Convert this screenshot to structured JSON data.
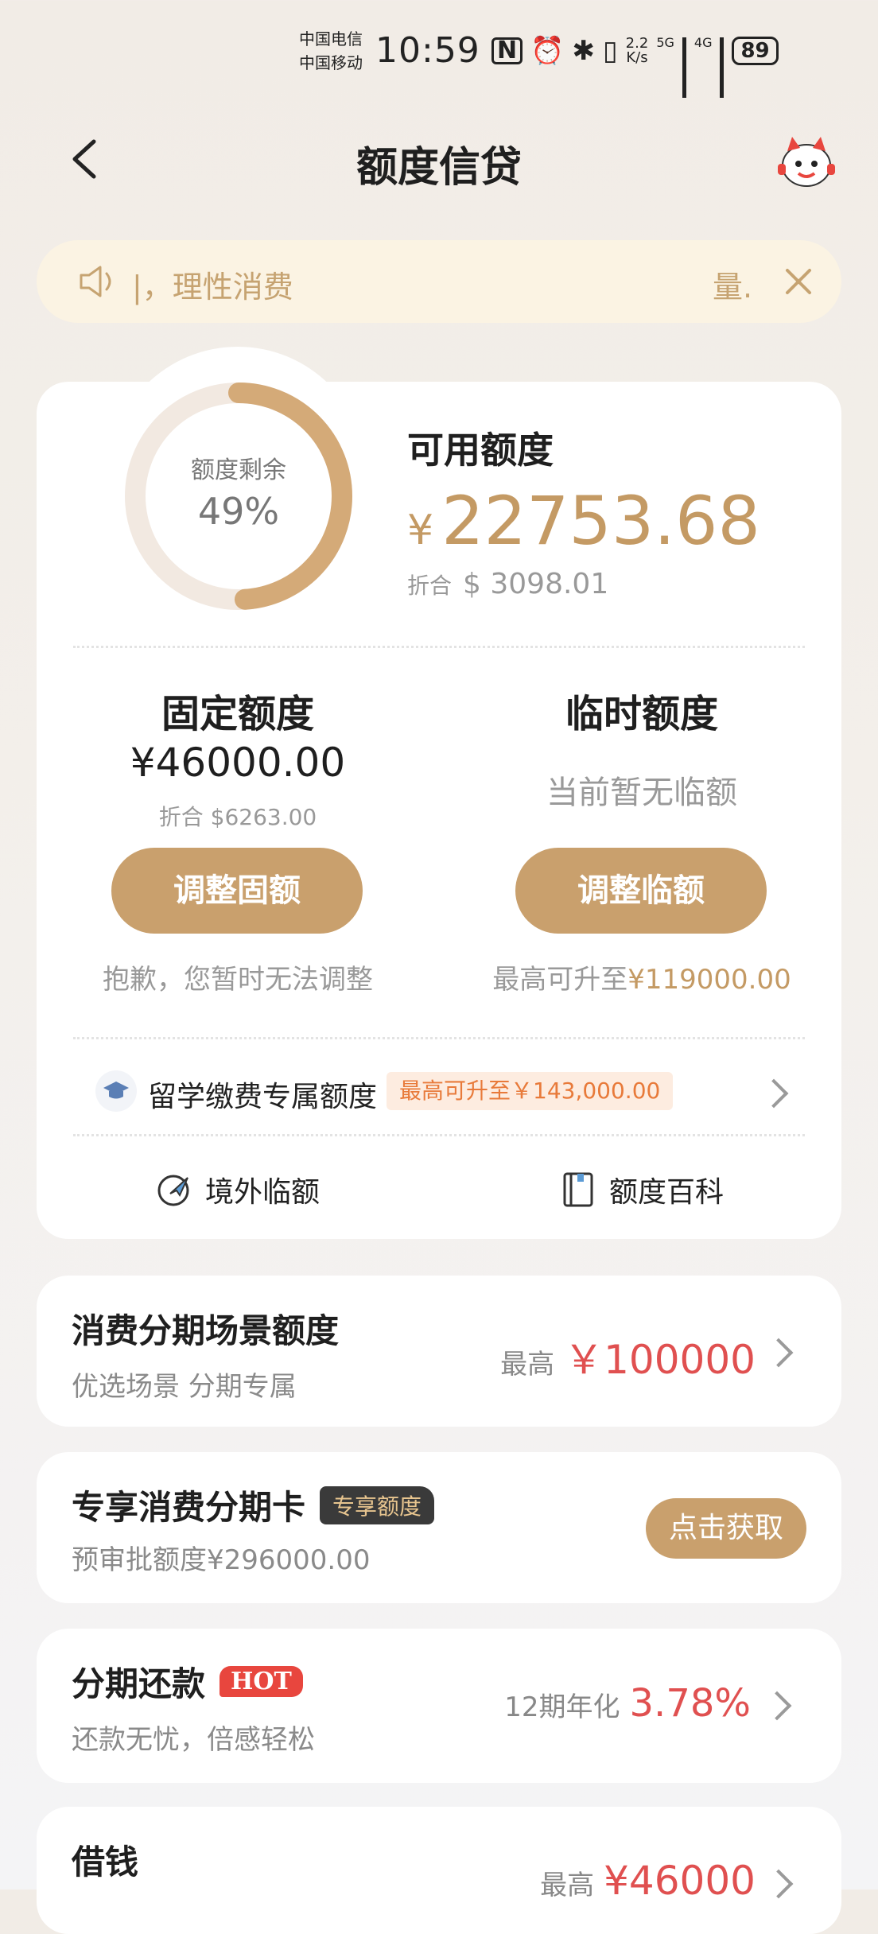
{
  "status_bar": {
    "carrier_1": "中国电信",
    "carrier_2": "中国移动",
    "time": "10:59",
    "net_speed_value": "2.2",
    "net_speed_unit": "K/s",
    "sig1_label": "5G",
    "sig2_label": "4G",
    "battery": "89"
  },
  "header": {
    "title": "额度信贷"
  },
  "notice": {
    "text": "|，理性消费",
    "text_tail": "量."
  },
  "summary": {
    "ring_label": "额度剩余",
    "ring_percent": "49%",
    "ring_fraction": 0.49,
    "available_label": "可用额度",
    "available_currency": "¥",
    "available_amount": "22753.68",
    "converted_prefix": "折合",
    "converted_amount": "$ 3098.01"
  },
  "fixed": {
    "title": "固定额度",
    "amount": "¥46000.00",
    "converted": "折合 $6263.00",
    "button": "调整固额",
    "note": "抱歉，您暂时无法调整"
  },
  "temporary": {
    "title": "临时额度",
    "status": "当前暂无临额",
    "button": "调整临额",
    "note_prefix": "最高可升至",
    "note_amount": "¥119000.00"
  },
  "study": {
    "label": "留学缴费专属额度",
    "badge": "最高可升至￥143,000.00"
  },
  "links": {
    "overseas": "境外临额",
    "wiki": "额度百科"
  },
  "installment_scene": {
    "title": "消费分期场景额度",
    "subtitle": "优选场景 分期专属",
    "right_label": "最高",
    "right_value": "￥100000"
  },
  "exclusive_card": {
    "title": "专享消费分期卡",
    "badge": "专享额度",
    "subtitle": "预审批额度¥296000.00",
    "button": "点击获取"
  },
  "repayment": {
    "title": "分期还款",
    "badge": "HOT",
    "subtitle": "还款无忧，倍感轻松",
    "right_label": "12期年化",
    "right_value": "3.78%"
  },
  "borrow": {
    "title": "借钱",
    "right_label": "最高",
    "right_value": "¥46000"
  },
  "colors": {
    "gold": "#c9a06d",
    "red": "#e05050",
    "ring_track": "#f2e9e1"
  }
}
